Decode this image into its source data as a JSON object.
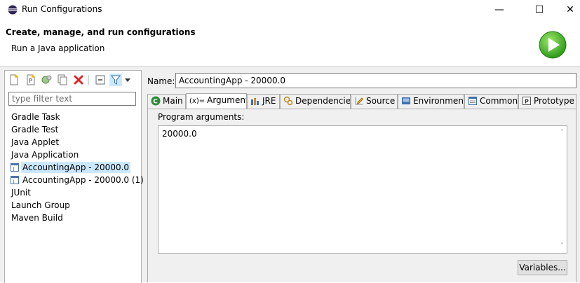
{
  "window": {
    "title": "Run Configurations",
    "minimize": "—",
    "maximize": "☐",
    "close": "✕"
  },
  "header": {
    "title": "Create, manage, and run configurations",
    "subtitle": "Run a Java application"
  },
  "sidebar": {
    "filter_placeholder": "type filter text",
    "items": [
      {
        "label": "Gradle Task",
        "level": 0,
        "selected": false
      },
      {
        "label": "Gradle Test",
        "level": 0,
        "selected": false
      },
      {
        "label": "Java Applet",
        "level": 0,
        "selected": false
      },
      {
        "label": "Java Application",
        "level": 0,
        "selected": false
      },
      {
        "label": "AccountingApp - 20000.0",
        "level": 1,
        "selected": true
      },
      {
        "label": "AccountingApp - 20000.0 (1)",
        "level": 1,
        "selected": false
      },
      {
        "label": "JUnit",
        "level": 0,
        "selected": false
      },
      {
        "label": "Launch Group",
        "level": 0,
        "selected": false
      },
      {
        "label": "Maven Build",
        "level": 0,
        "selected": false
      }
    ]
  },
  "form": {
    "name_label": "Name:",
    "name_value": "AccountingApp - 20000.0"
  },
  "tabs": [
    {
      "label": "Main",
      "icon": "main-class-icon",
      "active": false
    },
    {
      "label": "Arguments",
      "icon": "arguments-icon",
      "active": true
    },
    {
      "label": "JRE",
      "icon": "jre-icon",
      "active": false
    },
    {
      "label": "Dependencies",
      "icon": "dependencies-icon",
      "active": false
    },
    {
      "label": "Source",
      "icon": "source-icon",
      "active": false
    },
    {
      "label": "Environment",
      "icon": "environment-icon",
      "active": false
    },
    {
      "label": "Common",
      "icon": "common-icon",
      "active": false
    },
    {
      "label": "Prototype",
      "icon": "prototype-icon",
      "active": false
    }
  ],
  "arguments": {
    "program_label": "Program arguments:",
    "program_value": "20000.0",
    "variables_button": "Variables..."
  }
}
